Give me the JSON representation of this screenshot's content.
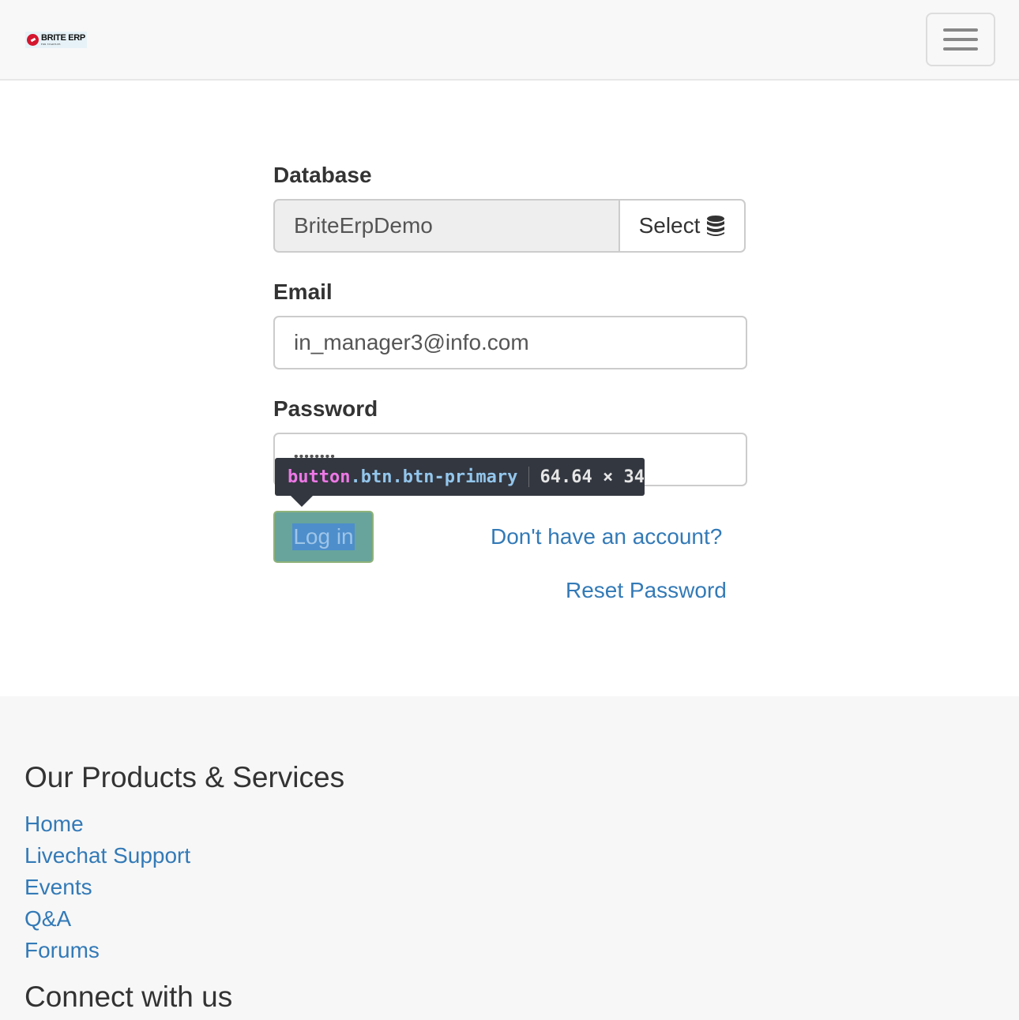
{
  "header": {
    "brand_name": "BRITE ERP",
    "brand_tagline": "FOR STARTUPS",
    "menu_toggle_icon": "hamburger-menu-icon"
  },
  "login_form": {
    "database": {
      "label": "Database",
      "value": "BriteErpDemo",
      "select_label": "Select",
      "select_icon": "database-icon"
    },
    "email": {
      "label": "Email",
      "value": "in_manager3@info.com"
    },
    "password": {
      "label": "Password",
      "masked_value": "••••••••"
    },
    "login_button_label": "Log in",
    "signup_link": "Don't have an account?",
    "reset_link": "Reset Password"
  },
  "devtools_tooltip": {
    "tag": "button",
    "classes": ".btn.btn-primary",
    "dimensions": "64.64 × 34"
  },
  "footer": {
    "products_heading": "Our Products & Services",
    "links": [
      "Home",
      "Livechat Support",
      "Events",
      "Q&A",
      "Forums"
    ],
    "connect_heading": "Connect with us"
  },
  "colors": {
    "link": "#337ab7",
    "primary_button": "#68a49c",
    "header_bg": "#f8f8f8",
    "footer_bg": "#f7f7f7"
  }
}
